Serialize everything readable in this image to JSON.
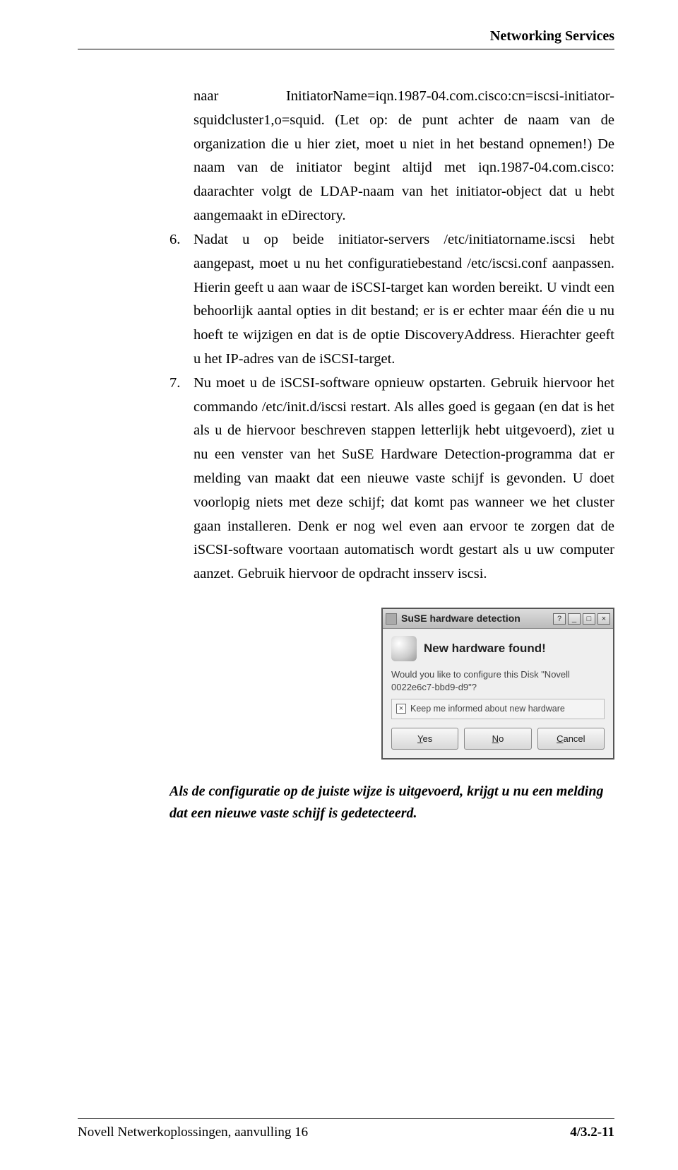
{
  "header": {
    "section": "Networking Services"
  },
  "body": {
    "intro": "naar InitiatorName=iqn.1987-04.com.cisco:cn=iscsi-initiator-squidcluster1,o=squid. (Let op: de punt achter de naam van de organization die u hier ziet, moet u niet in het bestand opnemen!) De naam van de initiator begint altijd met iqn.1987-04.com.cisco: daarachter volgt de LDAP-naam van het initiator-object dat u hebt aangemaakt in eDirectory.",
    "item6_num": "6.",
    "item6_text": "Nadat u op beide initiator-servers /etc/initiatorname.iscsi hebt aangepast, moet u nu het configuratiebestand /etc/iscsi.conf aanpassen. Hierin geeft u aan waar de iSCSI-target kan worden bereikt. U vindt een behoorlijk aantal opties in dit bestand; er is er echter maar één die u nu hoeft te wijzigen en dat is de optie DiscoveryAddress. Hierachter geeft u het IP-adres van de iSCSI-target.",
    "item7_num": "7.",
    "item7_text": "Nu moet u de iSCSI-software opnieuw opstarten. Gebruik hiervoor het commando /etc/init.d/iscsi restart. Als alles goed is gegaan (en dat is het als u de hiervoor beschreven stappen letterlijk hebt uitgevoerd), ziet u nu een venster van het SuSE Hardware Detection-programma dat er melding van maakt dat een nieuwe vaste schijf is gevonden. U doet voorlopig niets met deze schijf; dat komt pas wanneer we het cluster gaan installeren. Denk er nog wel even aan ervoor te zorgen dat de iSCSI-software voortaan automatisch wordt gestart als u uw computer aanzet. Gebruik hiervoor de opdracht insserv iscsi."
  },
  "dialog": {
    "titlebar": "SuSE hardware detection",
    "help": "?",
    "min": "_",
    "max": "□",
    "close": "×",
    "heading": "New hardware found!",
    "message": "Would you like to configure this Disk \"Novell 0022e6c7-bbd9-d9\"?",
    "checkbox_mark": "×",
    "checkbox_label": "Keep me informed about new hardware",
    "btn_yes_u": "Y",
    "btn_yes_r": "es",
    "btn_no_u": "N",
    "btn_no_r": "o",
    "btn_cancel_u": "C",
    "btn_cancel_r": "ancel"
  },
  "caption": "Als de configuratie op de juiste wijze is uitgevoerd, krijgt u nu een melding dat een nieuwe vaste schijf is gedetecteerd.",
  "footer": {
    "left": "Novell Netwerkoplossingen, aanvulling 16",
    "right": "4/3.2-11"
  }
}
